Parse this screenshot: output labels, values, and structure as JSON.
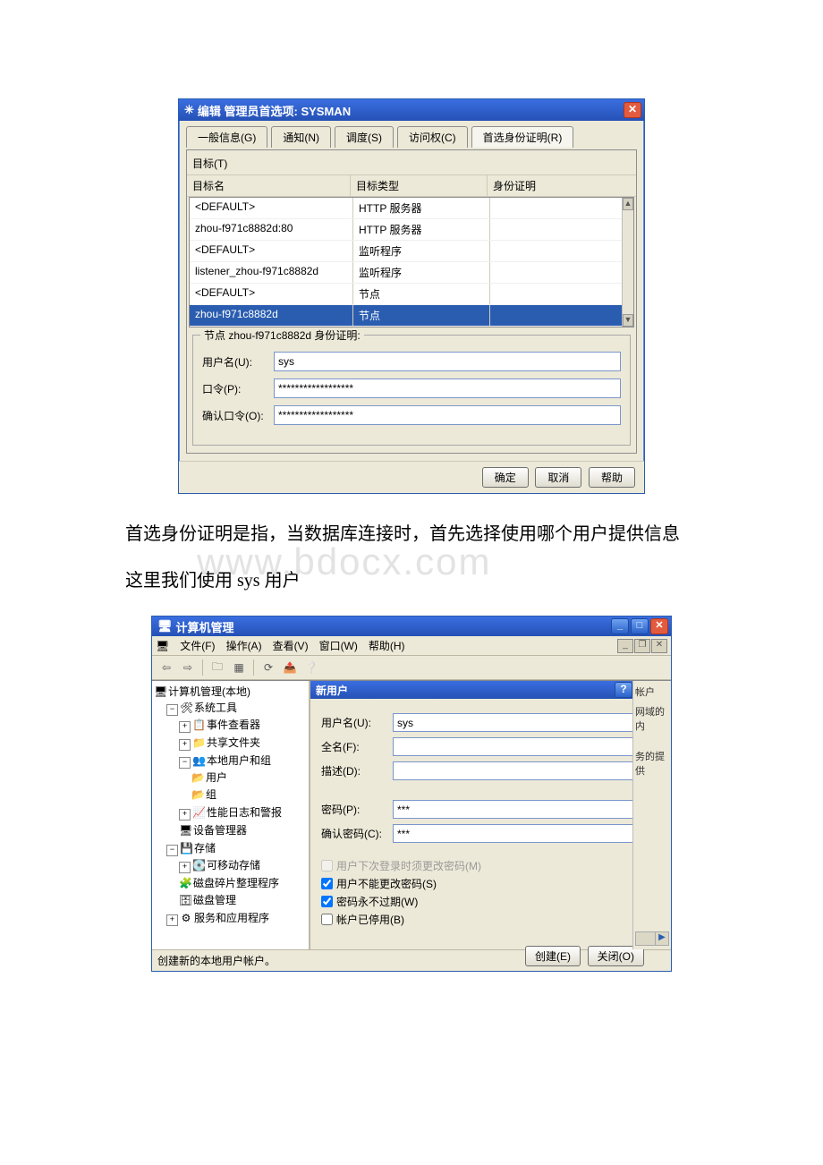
{
  "dialog1": {
    "title": "编辑  管理员首选项: SYSMAN",
    "tabs": [
      "一般信息(G)",
      "通知(N)",
      "调度(S)",
      "访问权(C)",
      "首选身份证明(R)"
    ],
    "active_tab_index": 4,
    "target_label": "目标(T)",
    "headers": {
      "name": "目标名",
      "type": "目标类型",
      "cred": "身份证明"
    },
    "rows": [
      {
        "name": "<DEFAULT>",
        "type": "HTTP 服务器",
        "cred": ""
      },
      {
        "name": "zhou-f971c8882d:80",
        "type": "HTTP 服务器",
        "cred": ""
      },
      {
        "name": "<DEFAULT>",
        "type": "监听程序",
        "cred": ""
      },
      {
        "name": "listener_zhou-f971c8882d",
        "type": "监听程序",
        "cred": ""
      },
      {
        "name": "<DEFAULT>",
        "type": "节点",
        "cred": ""
      },
      {
        "name": "zhou-f971c8882d",
        "type": "节点",
        "cred": ""
      }
    ],
    "selected_row_index": 5,
    "legend": "节点 zhou-f971c8882d 身份证明:",
    "fields": {
      "user_label": "用户名(U):",
      "user_value": "sys",
      "pwd_label": "口令(P):",
      "pwd_value": "******************",
      "pwd2_label": "确认口令(O):",
      "pwd2_value": "******************"
    },
    "buttons": {
      "ok": "确定",
      "cancel": "取消",
      "help": "帮助"
    }
  },
  "paragraph": {
    "watermark": "www.bdocx.com",
    "line1": "首选身份证明是指，当数据库连接时，首先选择使用哪个用户提供信息",
    "line2": "这里我们使用 sys 用户"
  },
  "dialog2": {
    "title": "计算机管理",
    "menus": [
      "文件(F)",
      "操作(A)",
      "查看(V)",
      "窗口(W)",
      "帮助(H)"
    ],
    "toolbar_icons": [
      "back-icon",
      "forward-icon",
      "up-icon",
      "views-icon",
      "refresh-icon",
      "export-icon",
      "help-icon"
    ],
    "tree": {
      "root": "计算机管理(本地)",
      "sys_tools": "系统工具",
      "event_viewer": "事件查看器",
      "shared": "共享文件夹",
      "local_users": "本地用户和组",
      "users": "用户",
      "groups": "组",
      "perf": "性能日志和警报",
      "devmgr": "设备管理器",
      "storage": "存储",
      "removable": "可移动存储",
      "defrag": "磁盘碎片整理程序",
      "diskmgr": "磁盘管理",
      "services": "服务和应用程序"
    },
    "newuser": {
      "title": "新用户",
      "user_label": "用户名(U):",
      "user_value": "sys",
      "full_label": "全名(F):",
      "full_value": "",
      "desc_label": "描述(D):",
      "desc_value": "",
      "pwd_label": "密码(P):",
      "pwd_value": "***",
      "pwd2_label": "确认密码(C):",
      "pwd2_value": "***",
      "chk1": "用户下次登录时须更改密码(M)",
      "chk2": "用户不能更改密码(S)",
      "chk3": "密码永不过期(W)",
      "chk4": "帐户已停用(B)",
      "create": "创建(E)",
      "close": "关闭(O)"
    },
    "side_text": [
      "帐户",
      "网域的内",
      "务的提供"
    ],
    "status": "创建新的本地用户帐户。"
  }
}
